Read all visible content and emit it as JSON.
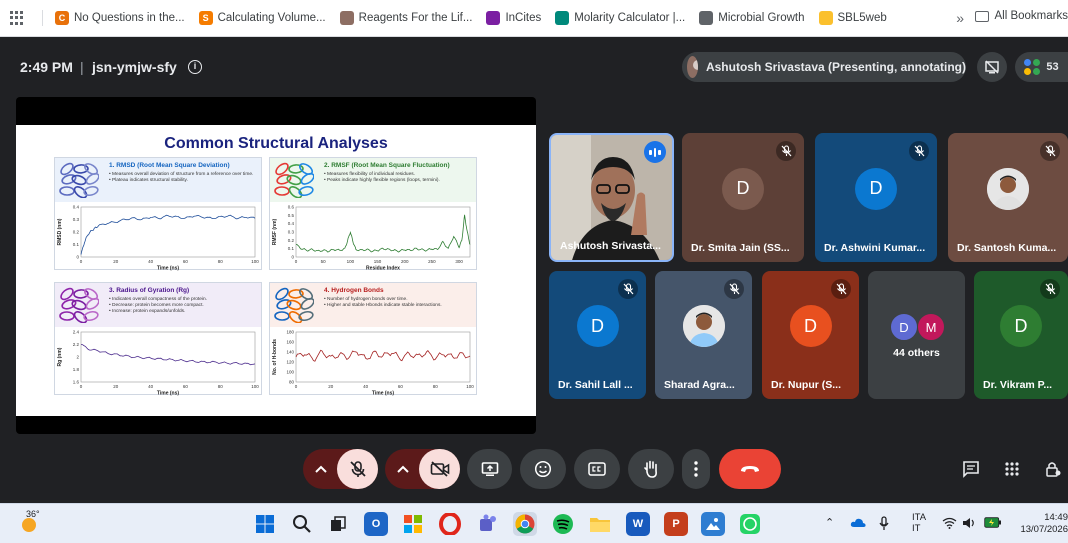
{
  "bookmarks": {
    "items": [
      {
        "label": "No Questions in the...",
        "icon": "orange-c-icon",
        "color": "#e8710a",
        "glyph": "C"
      },
      {
        "label": "Calculating Volume...",
        "icon": "s-icon",
        "color": "#f57c00",
        "glyph": "S"
      },
      {
        "label": "Reagents For the Lif...",
        "icon": "reagent-bird-icon",
        "color": "#8d6e63",
        "glyph": ""
      },
      {
        "label": "InCites",
        "icon": "incites-icon",
        "color": "#7b1fa2",
        "glyph": ""
      },
      {
        "label": "Molarity Calculator |...",
        "icon": "molarity-icon",
        "color": "#00897b",
        "glyph": ""
      },
      {
        "label": "Microbial Growth",
        "icon": "globe-icon",
        "color": "#5f6368",
        "glyph": ""
      },
      {
        "label": "SBL5web",
        "icon": "sbl-icon",
        "color": "#fbc02d",
        "glyph": ""
      }
    ],
    "overflow_glyph": "»",
    "all_label": "All Bookmarks"
  },
  "meet": {
    "time": "2:49 PM",
    "separator": "|",
    "code": "jsn-ymjw-sfy",
    "info_glyph": "i",
    "presenter_label": "Ashutosh Srivastava (Presenting, annotating)",
    "participant_count": "53"
  },
  "slide": {
    "title": "Common Structural Analyses",
    "panels": [
      {
        "heading": "1. RMSD (Root Mean Square Deviation)",
        "heading_color": "#1565c0",
        "bg": "#eaf1fb",
        "bullets": [
          "Measures overall deviation of structure from a reference over time.",
          "Plateau indicates structural stability."
        ],
        "ylabel": "RMSD (nm)",
        "xlabel": "Time (ns)",
        "line_color": "#1f4e9a"
      },
      {
        "heading": "2. RMSF (Root Mean Square Fluctuation)",
        "heading_color": "#2e7d32",
        "bg": "#edf7ee",
        "bullets": [
          "Measures flexibility of individual residues.",
          "Peaks indicate highly flexible regions (loops, termini)."
        ],
        "ylabel": "RMSF (nm)",
        "xlabel": "Residue Index",
        "line_color": "#2e7d32"
      },
      {
        "heading": "3. Radius of Gyration (Rg)",
        "heading_color": "#4a148c",
        "bg": "#f1ecf8",
        "bullets": [
          "Indicates overall compactness of the protein.",
          "Decrease: protein becomes more compact.",
          "Increase: protein expands/unfolds."
        ],
        "ylabel": "Rg (nm)",
        "xlabel": "Time (ns)",
        "line_color": "#4a2a8c"
      },
      {
        "heading": "4. Hydrogen Bonds",
        "heading_color": "#b71c1c",
        "bg": "#fbeeea",
        "bullets": [
          "Number of hydrogen bonds over time.",
          "Higher and stable Hbonds indicate stable interactions."
        ],
        "ylabel": "No. of H-bonds",
        "xlabel": "Time (ns)",
        "line_color": "#a32020"
      }
    ]
  },
  "chart_data": [
    {
      "type": "line",
      "title": "1. RMSD (Root Mean Square Deviation)",
      "xlabel": "Time (ns)",
      "ylabel": "RMSD (nm)",
      "xlim": [
        0,
        100
      ],
      "ylim": [
        0,
        0.4
      ],
      "xticks": [
        0,
        20,
        40,
        60,
        80,
        100
      ],
      "yticks": [
        0.0,
        0.1,
        0.2,
        0.3,
        0.4
      ],
      "x": [
        0,
        2,
        4,
        6,
        8,
        10,
        15,
        20,
        25,
        30,
        35,
        40,
        45,
        50,
        55,
        60,
        65,
        70,
        75,
        80,
        85,
        90,
        95,
        100
      ],
      "y": [
        0.02,
        0.12,
        0.18,
        0.21,
        0.23,
        0.25,
        0.27,
        0.28,
        0.3,
        0.31,
        0.3,
        0.32,
        0.31,
        0.33,
        0.32,
        0.31,
        0.33,
        0.32,
        0.31,
        0.32,
        0.33,
        0.31,
        0.32,
        0.31
      ]
    },
    {
      "type": "line",
      "title": "2. RMSF (Root Mean Square Fluctuation)",
      "xlabel": "Residue Index",
      "ylabel": "RMSF (nm)",
      "xlim": [
        0,
        320
      ],
      "ylim": [
        0,
        0.6
      ],
      "xticks": [
        0,
        50,
        100,
        150,
        200,
        250,
        300
      ],
      "yticks": [
        0.0,
        0.1,
        0.2,
        0.3,
        0.4,
        0.5,
        0.6
      ],
      "x": [
        0,
        10,
        20,
        30,
        40,
        50,
        60,
        70,
        80,
        90,
        95,
        100,
        105,
        110,
        120,
        130,
        140,
        150,
        160,
        170,
        180,
        190,
        200,
        210,
        220,
        230,
        240,
        250,
        260,
        270,
        280,
        290,
        300,
        305,
        310,
        315,
        320
      ],
      "y": [
        0.15,
        0.1,
        0.08,
        0.09,
        0.07,
        0.08,
        0.07,
        0.09,
        0.08,
        0.1,
        0.2,
        0.3,
        0.18,
        0.09,
        0.08,
        0.09,
        0.07,
        0.08,
        0.1,
        0.09,
        0.08,
        0.07,
        0.09,
        0.08,
        0.1,
        0.09,
        0.08,
        0.1,
        0.09,
        0.18,
        0.1,
        0.25,
        0.12,
        0.2,
        0.5,
        0.3,
        0.15
      ]
    },
    {
      "type": "line",
      "title": "3. Radius of Gyration (Rg)",
      "xlabel": "Time (ns)",
      "ylabel": "Rg (nm)",
      "xlim": [
        0,
        100
      ],
      "ylim": [
        1.6,
        2.4
      ],
      "xticks": [
        0,
        20,
        40,
        60,
        80,
        100
      ],
      "yticks": [
        1.6,
        1.8,
        2.0,
        2.2,
        2.4
      ],
      "x": [
        0,
        5,
        10,
        15,
        20,
        25,
        30,
        35,
        40,
        45,
        50,
        55,
        60,
        65,
        70,
        75,
        80,
        85,
        90,
        95,
        100
      ],
      "y": [
        2.2,
        2.12,
        2.1,
        2.06,
        2.04,
        2.02,
        2.0,
        1.99,
        1.98,
        1.97,
        1.96,
        1.95,
        1.94,
        1.93,
        1.92,
        1.92,
        1.91,
        1.9,
        1.9,
        1.89,
        1.89
      ]
    },
    {
      "type": "line",
      "title": "4. Hydrogen Bonds",
      "xlabel": "Time (ns)",
      "ylabel": "No. of H-bonds",
      "xlim": [
        0,
        100
      ],
      "ylim": [
        80,
        180
      ],
      "xticks": [
        0,
        20,
        40,
        60,
        80,
        100
      ],
      "yticks": [
        80,
        100,
        120,
        140,
        160,
        180
      ],
      "x": [
        0,
        5,
        10,
        15,
        20,
        25,
        30,
        35,
        40,
        45,
        50,
        55,
        60,
        65,
        70,
        75,
        80,
        85,
        90,
        95,
        100
      ],
      "y": [
        130,
        138,
        125,
        140,
        128,
        135,
        130,
        142,
        126,
        138,
        132,
        140,
        127,
        136,
        131,
        139,
        128,
        137,
        130,
        135,
        132
      ]
    }
  ],
  "participants": [
    {
      "name": "Ashutosh Srivasta...",
      "type": "video",
      "speaking": true
    },
    {
      "name": "Dr. Smita Jain (SS...",
      "type": "letter",
      "letter": "D",
      "tile_bg": "#5d4037",
      "avatar_bg": "#7b5a4e",
      "muted": true
    },
    {
      "name": "Dr. Ashwini Kumar...",
      "type": "letter",
      "letter": "D",
      "tile_bg": "#134a7a",
      "avatar_bg": "#0b78d0",
      "muted": true
    },
    {
      "name": "Dr. Santosh Kuma...",
      "type": "photo",
      "tile_bg": "#6d4c41",
      "muted": true
    },
    {
      "name": "Dr. Sahil Lall ...",
      "type": "letter",
      "letter": "D",
      "tile_bg": "#134a7a",
      "avatar_bg": "#0b78d0",
      "muted": true
    },
    {
      "name": "Sharad Agra...",
      "type": "photo",
      "tile_bg": "#45556a",
      "muted": true
    },
    {
      "name": "Dr. Nupur (S...",
      "type": "letter",
      "letter": "D",
      "tile_bg": "#8a2f1a",
      "avatar_bg": "#e8501f",
      "muted": true
    },
    {
      "name": "44 others",
      "type": "others",
      "letters": [
        "D",
        "M"
      ]
    },
    {
      "name": "Dr. Vikram P...",
      "type": "letter",
      "letter": "D",
      "tile_bg": "#1e5a2a",
      "avatar_bg": "#2e7d32",
      "muted": true
    }
  ],
  "taskbar": {
    "temperature": "36°",
    "language": "ITA",
    "language_sub": "IT",
    "time": "14:49",
    "date": "13/07/2026"
  },
  "colors": {
    "end_call": "#ea4335",
    "muted_control": "#f9dedc",
    "meet_bg": "#202124"
  }
}
